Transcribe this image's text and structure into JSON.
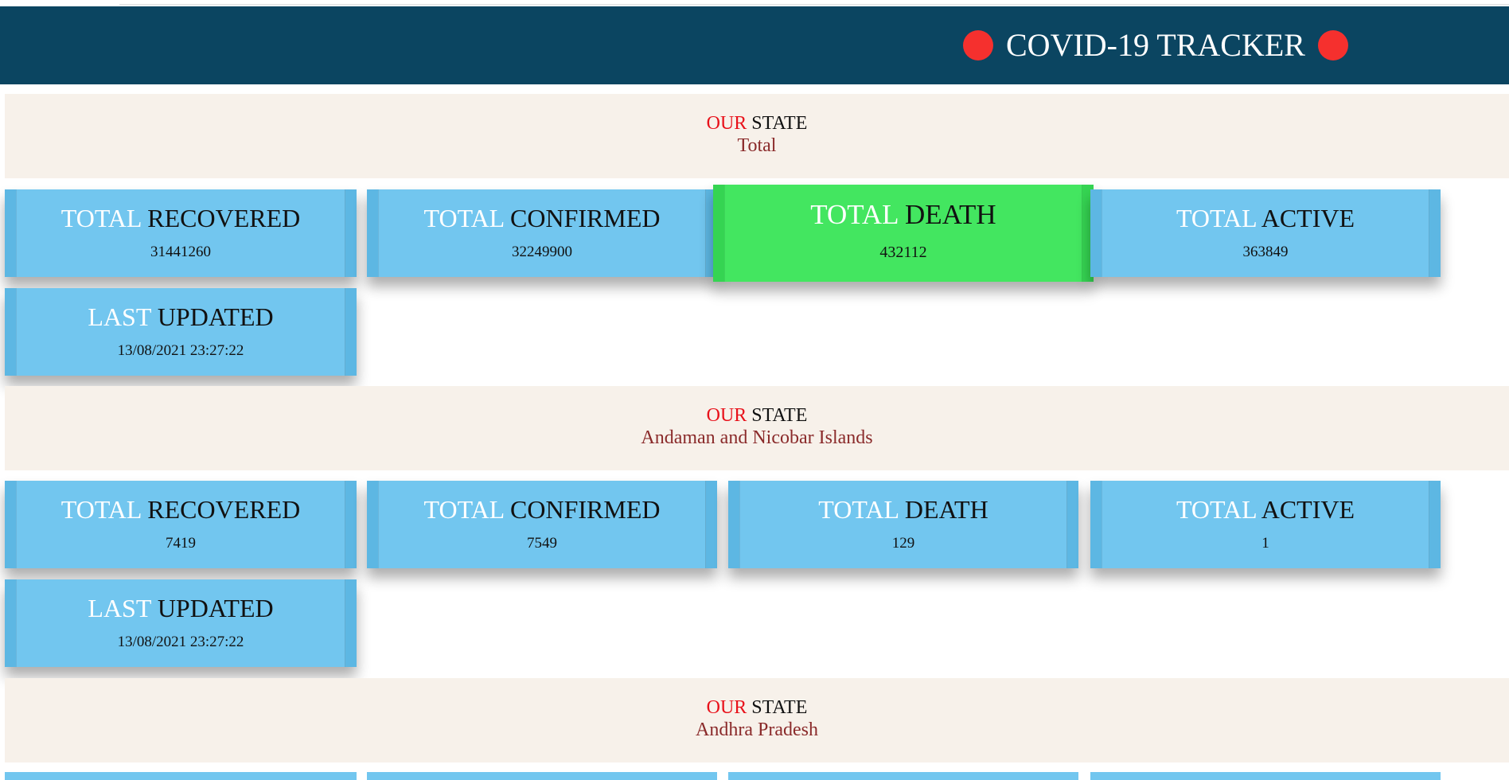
{
  "header": {
    "title": "COVID-19 TRACKER",
    "dot_color": "#f5302e"
  },
  "sections": [
    {
      "our": "OUR",
      "state": "STATE",
      "name": "Total",
      "recovered": {
        "prefix": "TOTAL",
        "label": "RECOVERED",
        "value": "31441260"
      },
      "confirmed": {
        "prefix": "TOTAL",
        "label": "CONFIRMED",
        "value": "32249900"
      },
      "death": {
        "prefix": "TOTAL",
        "label": "DEATH",
        "value": "432112"
      },
      "active": {
        "prefix": "TOTAL",
        "label": "ACTIVE",
        "value": "363849"
      },
      "updated": {
        "prefix": "LAST",
        "label": "UPDATED",
        "value": "13/08/2021 23:27:22"
      }
    },
    {
      "our": "OUR",
      "state": "STATE",
      "name": "Andaman and Nicobar Islands",
      "recovered": {
        "prefix": "TOTAL",
        "label": "RECOVERED",
        "value": "7419"
      },
      "confirmed": {
        "prefix": "TOTAL",
        "label": "CONFIRMED",
        "value": "7549"
      },
      "death": {
        "prefix": "TOTAL",
        "label": "DEATH",
        "value": "129"
      },
      "active": {
        "prefix": "TOTAL",
        "label": "ACTIVE",
        "value": "1"
      },
      "updated": {
        "prefix": "LAST",
        "label": "UPDATED",
        "value": "13/08/2021 23:27:22"
      }
    },
    {
      "our": "OUR",
      "state": "STATE",
      "name": "Andhra Pradesh"
    }
  ],
  "colors": {
    "header_bg": "#0b4561",
    "card_bg": "#72c6ef",
    "card_highlight_bg": "#43e660",
    "state_bar_bg": "#f7f1ea",
    "our_text": "#e8111a",
    "state_name_text": "#8a2a2a"
  }
}
